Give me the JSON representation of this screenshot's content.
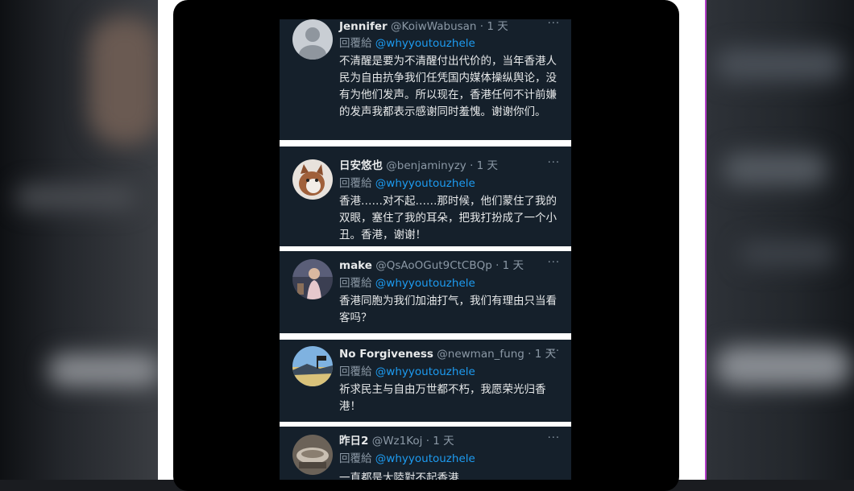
{
  "tweets": [
    {
      "name": "Jennifer",
      "handle": "@KoiwWabusan",
      "time": "· 1 天",
      "reply_label": "回覆給",
      "reply_to": "@whyyoutouzhele",
      "more": "···",
      "text": "不清醒是要为不清醒付出代价的，当年香港人民为自由抗争我们任凭国内媒体操纵舆论，没有为他们发声。所以现在，香港任何不计前嫌的发声我都表示感谢同时羞愧。谢谢你们。"
    },
    {
      "name": "日安悠也",
      "handle": "@benjaminyzy",
      "time": "· 1 天",
      "reply_label": "回覆給",
      "reply_to": "@whyyoutouzhele",
      "more": "···",
      "text": "香港……对不起……那时候，他们蒙住了我的双眼，塞住了我的耳朵，把我打扮成了一个小丑。香港，谢谢！"
    },
    {
      "name": "make",
      "handle": "@QsAoOGut9CtCBQp",
      "time": "· 1 天",
      "reply_label": "回覆給",
      "reply_to": "@whyyoutouzhele",
      "more": "···",
      "text": "香港同胞为我们加油打气，我们有理由只当看客吗？"
    },
    {
      "name": "No Forgiveness",
      "handle": "@newman_fung",
      "time": "· 1 天",
      "reply_label": "回覆給",
      "reply_to": "@whyyoutouzhele",
      "more": "···",
      "text": "祈求民主与自由万世都不朽，我愿荣光归香港！"
    },
    {
      "name": "昨日2",
      "handle": "@Wz1Koj",
      "time": "· 1 天",
      "reply_label": "回覆給",
      "reply_to": "@whyyoutouzhele",
      "more": "···",
      "text": "一直都是大陸對不起香港"
    }
  ],
  "colors": {
    "tweet_bg": "#15202b",
    "name": "#e7e9ea",
    "secondary": "#8b98a5",
    "mention": "#1d9bf0"
  }
}
